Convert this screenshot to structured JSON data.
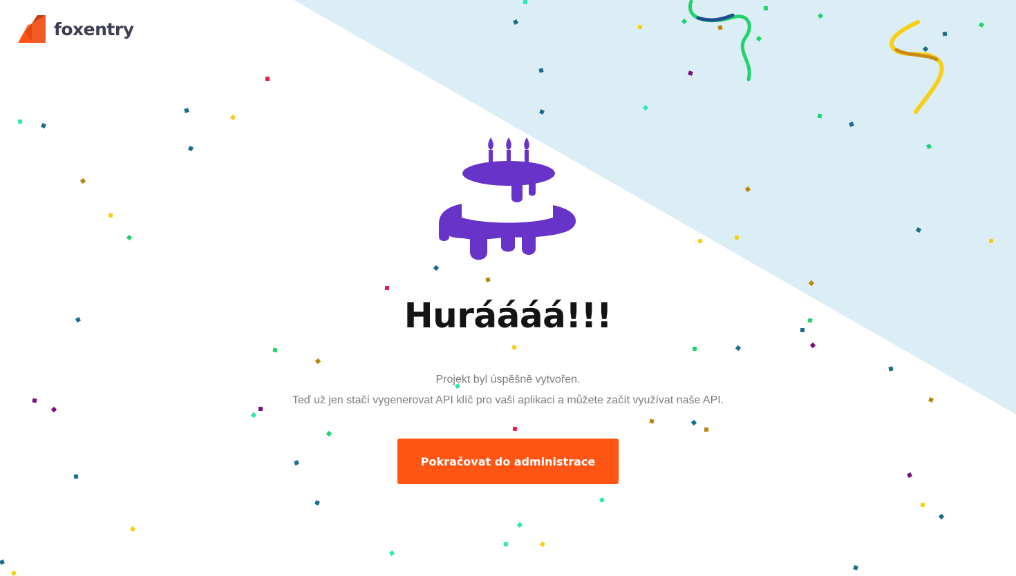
{
  "brand": {
    "name": "foxentry",
    "accent": "#fe5515",
    "cake_color": "#6833c9",
    "background_tint": "#dbeef6"
  },
  "main": {
    "title": "Huráááá!!!",
    "message_line1": "Projekt byl úspěšně vytvořen.",
    "message_line2": "Teď už jen stačí vygenerovat API klíč pro vaši aplikaci a můžete začít využívat naše API.",
    "continue_button_label": "Pokračovat do administrace"
  },
  "icons": {
    "logo": "fox-logo-icon",
    "cake": "birthday-cake-icon",
    "confetti": "confetti-decoration",
    "streamers": "party-streamer-icon"
  }
}
